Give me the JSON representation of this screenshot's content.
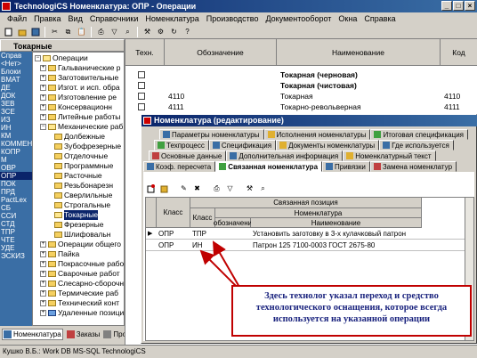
{
  "window": {
    "title": "TechnologiCS Номенклатура: ОПР - Операции"
  },
  "menu": [
    "Файл",
    "Правка",
    "Вид",
    "Справочники",
    "Номенклатура",
    "Производство",
    "Документооборот",
    "Окна",
    "Справка"
  ],
  "left": {
    "header": "Токарные",
    "strip": [
      "Справ",
      "<Нет>",
      "Блоки",
      "ВМАТ",
      "ДЕ",
      "ДОК",
      "ЗЕВ",
      "ЗСЕ",
      "ИЗ",
      "ИН",
      "КМ",
      "КОММЕН",
      "КОПР",
      "М",
      "ОВР",
      "ОПР",
      "ПОК",
      "ПРД",
      "PactLex",
      "СБ",
      "ССИ",
      "СТД",
      "ТПР",
      "ЧТЕ",
      "УДЕ",
      "ЭСКИЗ"
    ],
    "tree": [
      "Операции",
      "Гальванические р",
      "Заготовительные",
      "Изгот. и исп. обра",
      "Изготовление ре",
      "Консервационн",
      "Литейные работы",
      "Механические раб",
      "Долбежные",
      "Зубофрезерные",
      "Отделочные",
      "Программные",
      "Расточные",
      "Резьбонарезн",
      "Сверлильные",
      "Строгальные",
      "Токарные",
      "Фрезерные",
      "Шлифовальн",
      "Операции общего",
      "Пайка",
      "Покрасочные рабо",
      "Сварочные работ",
      "Слесарно-сборочн",
      "Термические раб",
      "Технический конт",
      "Удаленные позици"
    ],
    "bottom_tabs": [
      "Номенклатура",
      "Заказы",
      "Производство"
    ]
  },
  "grid": {
    "headers": [
      "Техн.",
      "Обозначение",
      "Наименование",
      "Код"
    ],
    "rows": [
      {
        "code": "",
        "name": "Токарная (черновая)",
        "kod": "",
        "bold": true
      },
      {
        "code": "",
        "name": "Токарная (чистовая)",
        "kod": "",
        "bold": true
      },
      {
        "code": "4110",
        "name": "Токарная",
        "kod": "4110"
      },
      {
        "code": "4111",
        "name": "Токарно-револьверная",
        "kod": "4111"
      }
    ]
  },
  "dialog": {
    "title": "Номенклатура (редактирование)",
    "tabs_row1": [
      "Параметры номенклатуры",
      "Исполнения номенклатуры",
      "Итоговая спецификация"
    ],
    "tabs_row2": [
      "Техпроцесс",
      "Спецификация",
      "Документы номенклатуры",
      "Где используется"
    ],
    "tabs_row3": [
      "Основные данные",
      "Дополнительная информация",
      "Номенклатурный текст"
    ],
    "tabs_row4": [
      "Коэф. пересчета",
      "Связанная номенклатура",
      "Привязки",
      "Замена номенклатур"
    ],
    "inner_headers": {
      "class": "Класс",
      "linked": "Связанная позиция",
      "linked_class": "Класс",
      "nomenclature": "Номенклатура",
      "designation": "обозначени",
      "name": "Наименование"
    },
    "inner_rows": [
      {
        "cls": "ОПР",
        "sub": "ТПР",
        "des": "",
        "name": "Установить заготовку в 3-х кулачковый патрон"
      },
      {
        "cls": "ОПР",
        "sub": "ИН",
        "des": "",
        "name": "Патрон 125 7100-0003 ГОСТ 2675-80"
      }
    ]
  },
  "note": "Здесь технолог указал переход и средство технологического оснащения, которое всегда используется на указанной операции",
  "status": "Кушко В.Б.: Work DB MS-SQL TechnologiCS"
}
